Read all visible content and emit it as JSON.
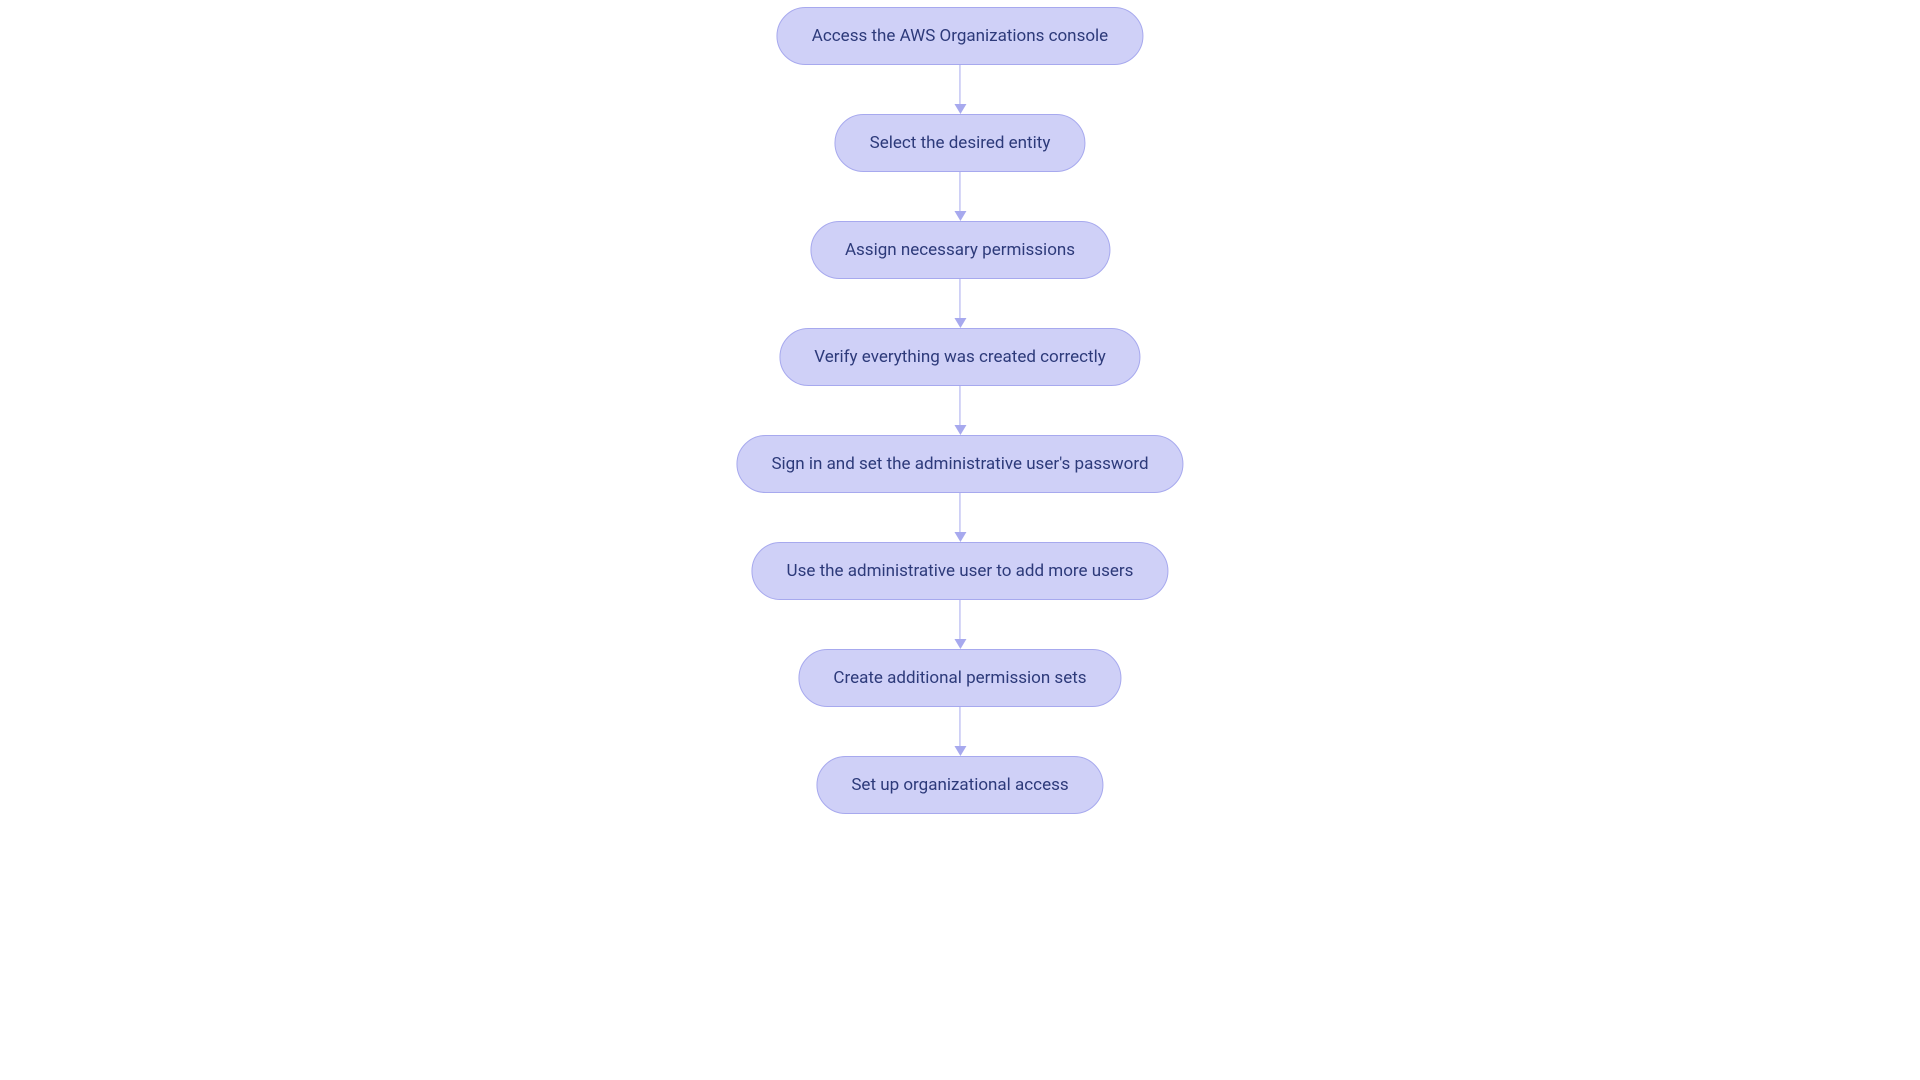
{
  "flowchart": {
    "nodes": [
      {
        "label": "Access the AWS Organizations console"
      },
      {
        "label": "Select the desired entity"
      },
      {
        "label": "Assign necessary permissions"
      },
      {
        "label": "Verify everything was created correctly"
      },
      {
        "label": "Sign in and set the administrative user's password"
      },
      {
        "label": "Use the administrative user to add more users"
      },
      {
        "label": "Create additional permission sets"
      },
      {
        "label": "Set up organizational access"
      }
    ],
    "colors": {
      "node_fill": "#cfd0f7",
      "node_border": "#a7a9ee",
      "text": "#2d3a7a",
      "arrow": "#a7a9ee"
    }
  }
}
